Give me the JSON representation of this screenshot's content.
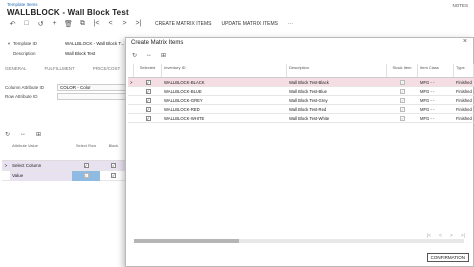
{
  "header": {
    "breadcrumb": "Template Items",
    "title": "WALLBLOCK - Wall Block Test",
    "notes": "NOTES"
  },
  "toolbar": {
    "create_matrix": "CREATE MATRIX ITEMS",
    "update_matrix": "UPDATE MATRIX ITEMS",
    "more": "···"
  },
  "form": {
    "template_id_label": "Template ID",
    "template_id_value": "WALLBLOCK - Wall Block T...",
    "description_label": "Description",
    "description_value": "Wall Block Test",
    "tabs": [
      "GENERAL",
      "FULFILLMENT",
      "PRICE/COST"
    ],
    "column_attr_label": "Column Attribute ID",
    "column_attr_value": "COLOR - Color",
    "row_attr_label": "Row Attribute ID",
    "row_attr_value": ""
  },
  "attr_grid": {
    "headers": [
      "Attribute Value",
      "Select Row",
      "Black"
    ],
    "rows": [
      {
        "label": "Select Column"
      },
      {
        "label": "Value"
      }
    ]
  },
  "dialog": {
    "title": "Create Matrix Items",
    "close": "×",
    "columns": [
      "Selected",
      "Inventory ID",
      "Description",
      "Stock Item",
      "Item Class",
      "Type"
    ],
    "rows": [
      {
        "inventory_id": "WALLBLOCK-BLACK",
        "description": "Wall Block Test-Black",
        "item_class": "MFG - -",
        "type": "Finished"
      },
      {
        "inventory_id": "WALLBLOCK-BLUE",
        "description": "Wall Block Test-Blue",
        "item_class": "MFG - -",
        "type": "Finished"
      },
      {
        "inventory_id": "WALLBLOCK-GREY",
        "description": "Wall Block Test-Grey",
        "item_class": "MFG - -",
        "type": "Finished"
      },
      {
        "inventory_id": "WALLBLOCK-RED",
        "description": "Wall Block Test-Red",
        "item_class": "MFG - -",
        "type": "Finished"
      },
      {
        "inventory_id": "WALLBLOCK-WHITE",
        "description": "Wall Block Test-White",
        "item_class": "MFG - -",
        "type": "Finished"
      }
    ],
    "pager": [
      "|<",
      "<",
      ">",
      ">|"
    ],
    "confirm": "CONFIRMATION"
  },
  "colors": {
    "accent": "#2a6fb5",
    "row_highlight": "#f4dde3",
    "select_col_bg": "#e8e2f0",
    "value_cell_bg": "#8fbbe3"
  }
}
